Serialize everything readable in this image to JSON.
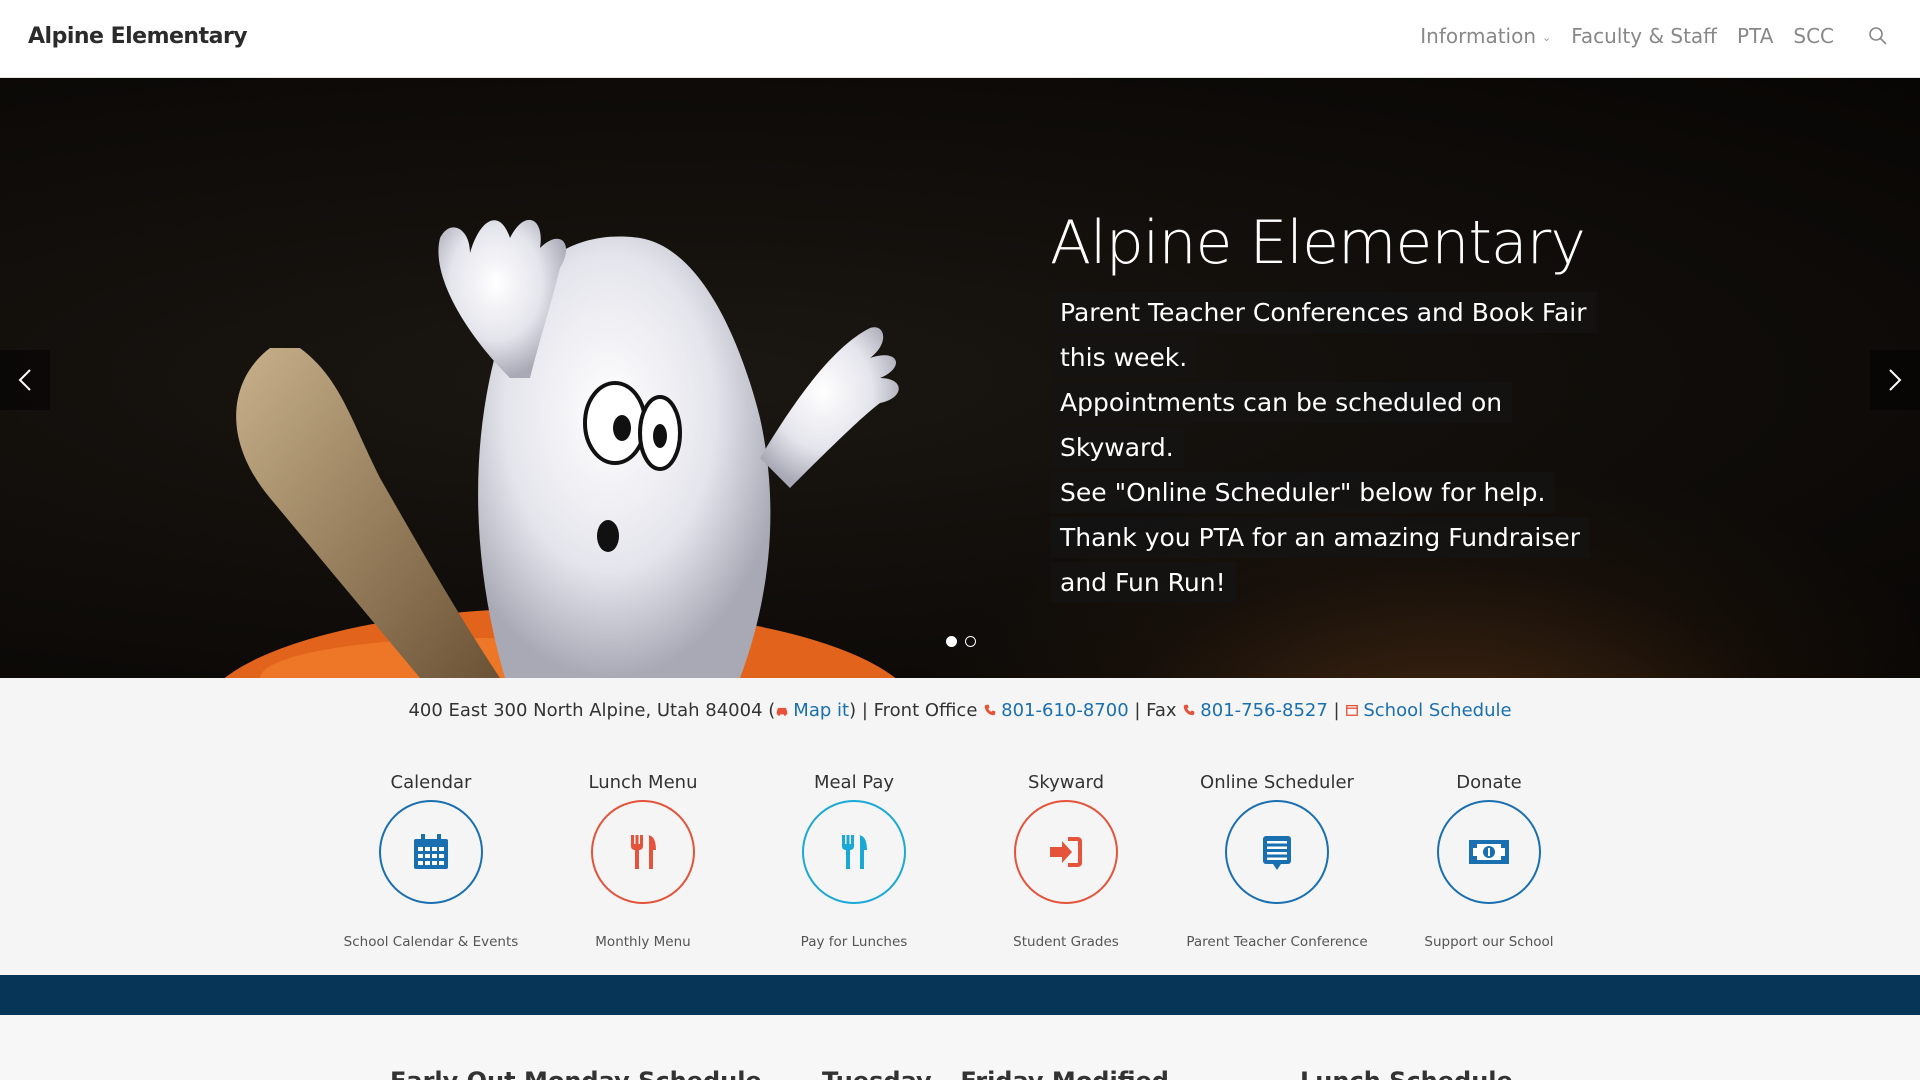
{
  "header": {
    "brand": "Alpine Elementary",
    "nav": [
      {
        "label": "Information",
        "has_dropdown": true
      },
      {
        "label": "Faculty & Staff"
      },
      {
        "label": "PTA"
      },
      {
        "label": "SCC"
      }
    ],
    "search_icon": "search-icon"
  },
  "hero": {
    "title": "Alpine Elementary",
    "lines": [
      "Parent Teacher Conferences and Book Fair this week.",
      "Appointments can be scheduled on Skyward.",
      "See \"Online Scheduler\" below for help.",
      "Thank you PTA for an amazing Fundraiser and Fun Run!"
    ],
    "slides": 2,
    "active_slide": 1
  },
  "info": {
    "address": "400 East 300 North Alpine, Utah 84004 (",
    "map_link": "Map it",
    "front_office_label": ") | Front Office",
    "phone": "801-610-8700",
    "fax_label": "| Fax",
    "fax": "801-756-8527",
    "sep": "|",
    "schedule_link": "School Schedule",
    "icon_color": "#e4533a",
    "link_color": "#1a6fb0"
  },
  "quick_links": [
    {
      "title": "Calendar",
      "subtitle": "School Calendar & Events",
      "icon": "calendar-icon",
      "color": "#1a6fb0"
    },
    {
      "title": "Lunch Menu",
      "subtitle": "Monthly Menu",
      "icon": "utensils-icon",
      "color": "#e4533a"
    },
    {
      "title": "Meal Pay",
      "subtitle": "Pay for Lunches",
      "icon": "utensils-icon",
      "color": "#1aa9d6"
    },
    {
      "title": "Skyward",
      "subtitle": "Student Grades",
      "icon": "sign-in-icon",
      "color": "#e4533a"
    },
    {
      "title": "Online Scheduler",
      "subtitle": "Parent Teacher Conference",
      "icon": "list-icon",
      "color": "#1a6fb0"
    },
    {
      "title": "Donate",
      "subtitle": "Support our School",
      "icon": "money-icon",
      "color": "#1a6fb0"
    }
  ],
  "band_color": "#063558",
  "bottom_headings": [
    "Early Out Monday Schedule",
    "Tuesday – Friday Modified",
    "Lunch Schedule"
  ]
}
